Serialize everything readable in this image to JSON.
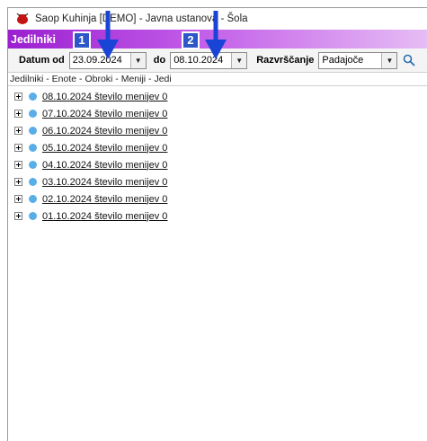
{
  "window": {
    "title": "Saop Kuhinja [DEMO] - Javna ustanova - Šola"
  },
  "header": {
    "title": "Jedilniki",
    "callout_1": "1",
    "callout_2": "2"
  },
  "toolbar": {
    "date_from_label": "Datum od",
    "date_from_value": "23.09.2024",
    "date_to_label": "do",
    "date_to_value": "08.10.2024",
    "sort_label": "Razvrščanje",
    "sort_value": "Padajoče"
  },
  "breadcrumb": "Jedilniki - Enote - Obroki - Meniji - Jedi",
  "tree_items": [
    "08.10.2024  število menijev 0",
    "07.10.2024  število menijev 0",
    "06.10.2024  število menijev 0",
    "05.10.2024  število menijev 0",
    "04.10.2024  število menijev 0",
    "03.10.2024  število menijev 0",
    "02.10.2024  število menijev 0",
    "01.10.2024  število menijev 0"
  ],
  "colors": {
    "accent_arrow": "#1a44d6",
    "header_start": "#9b1fd0",
    "tree_dot": "#5aaee8"
  },
  "icons": [
    "app-logo-icon",
    "search-icon",
    "chevron-down-icon",
    "expand-icon"
  ]
}
